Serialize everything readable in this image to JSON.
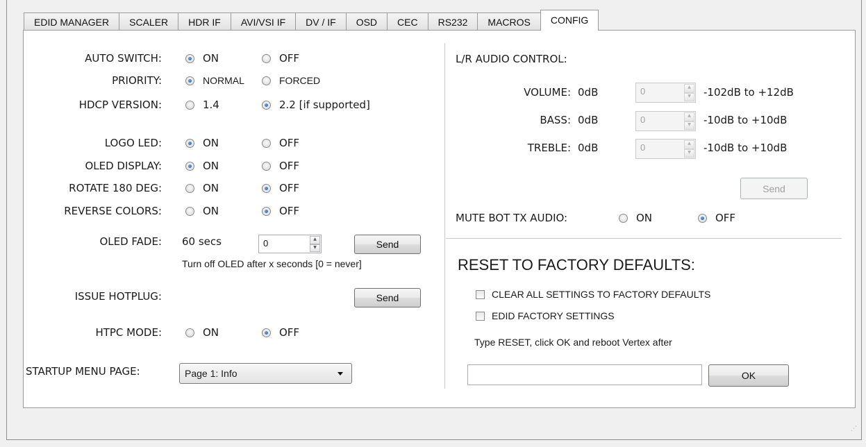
{
  "tabs": [
    "EDID MANAGER",
    "SCALER",
    "HDR IF",
    "AVI/VSI IF",
    "DV / IF",
    "OSD",
    "CEC",
    "RS232",
    "MACROS",
    "CONFIG"
  ],
  "active_tab": "CONFIG",
  "left": {
    "auto_switch": {
      "label": "AUTO SWITCH:",
      "on": "ON",
      "off": "OFF",
      "selected": "ON"
    },
    "priority": {
      "label": "PRIORITY:",
      "normal": "NORMAL",
      "forced": "FORCED",
      "selected": "NORMAL"
    },
    "hdcp_version": {
      "label": "HDCP VERSION:",
      "v14": "1.4",
      "v22": "2.2 [if supported]",
      "selected": "2.2 [if supported]"
    },
    "logo_led": {
      "label": "LOGO LED:",
      "on": "ON",
      "off": "OFF",
      "selected": "ON"
    },
    "oled_display": {
      "label": "OLED DISPLAY:",
      "on": "ON",
      "off": "OFF",
      "selected": "ON"
    },
    "rotate_180": {
      "label": "ROTATE 180 DEG:",
      "on": "ON",
      "off": "OFF",
      "selected": "OFF"
    },
    "reverse_colors": {
      "label": "REVERSE COLORS:",
      "on": "ON",
      "off": "OFF",
      "selected": "OFF"
    },
    "oled_fade": {
      "label": "OLED FADE:",
      "current": "60 secs",
      "input_value": "0",
      "send": "Send",
      "hint": "Turn off OLED after x seconds [0 = never]"
    },
    "issue_hotplug": {
      "label": "ISSUE HOTPLUG:",
      "send": "Send"
    },
    "htpc_mode": {
      "label": "HTPC MODE:",
      "on": "ON",
      "off": "OFF",
      "selected": "OFF"
    },
    "startup_menu_page": {
      "label": "STARTUP MENU PAGE:",
      "value": "Page 1: Info"
    }
  },
  "right": {
    "audio_title": "L/R AUDIO CONTROL:",
    "volume": {
      "label": "VOLUME:",
      "current": "0dB",
      "input_value": "0",
      "range": "-102dB to +12dB"
    },
    "bass": {
      "label": "BASS:",
      "current": "0dB",
      "input_value": "0",
      "range": "-10dB to +10dB"
    },
    "treble": {
      "label": "TREBLE:",
      "current": "0dB",
      "input_value": "0",
      "range": "-10dB to +10dB"
    },
    "audio_send": "Send",
    "mute_bot": {
      "label": "MUTE BOT TX AUDIO:",
      "on": "ON",
      "off": "OFF",
      "selected": "OFF"
    },
    "reset_title": "RESET TO FACTORY DEFAULTS:",
    "clear_all": "CLEAR ALL SETTINGS TO FACTORY DEFAULTS",
    "edid_factory": "EDID FACTORY SETTINGS",
    "reset_hint": "Type RESET, click OK and reboot Vertex after",
    "reset_input": "",
    "ok": "OK"
  }
}
